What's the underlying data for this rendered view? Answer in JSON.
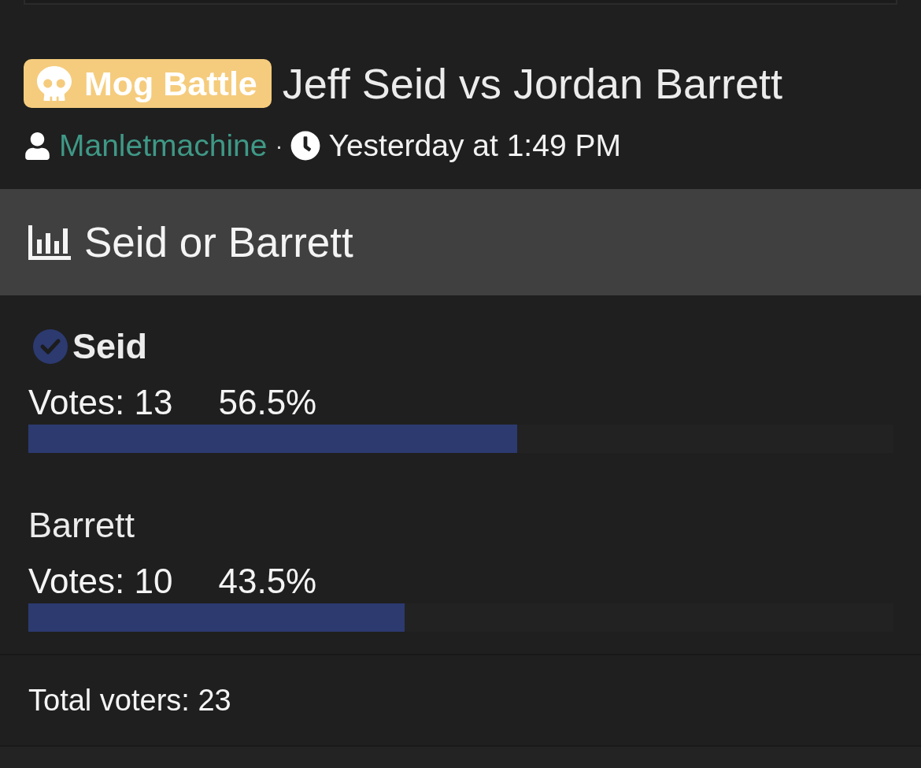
{
  "thread": {
    "prefix": {
      "label": "Mog Battle"
    },
    "title": "Jeff Seid vs Jordan Barrett",
    "author": "Manletmachine",
    "separator": "·",
    "time": "Yesterday at 1:49 PM"
  },
  "poll": {
    "question": "Seid or Barrett",
    "options": [
      {
        "label": "Seid",
        "selected": true,
        "votes": "Votes: 13",
        "percent": "56.5%",
        "level": 0.565
      },
      {
        "label": "Barrett",
        "selected": false,
        "votes": "Votes: 10",
        "percent": "43.5%",
        "level": 0.435
      }
    ],
    "total": "Total voters: 23"
  }
}
